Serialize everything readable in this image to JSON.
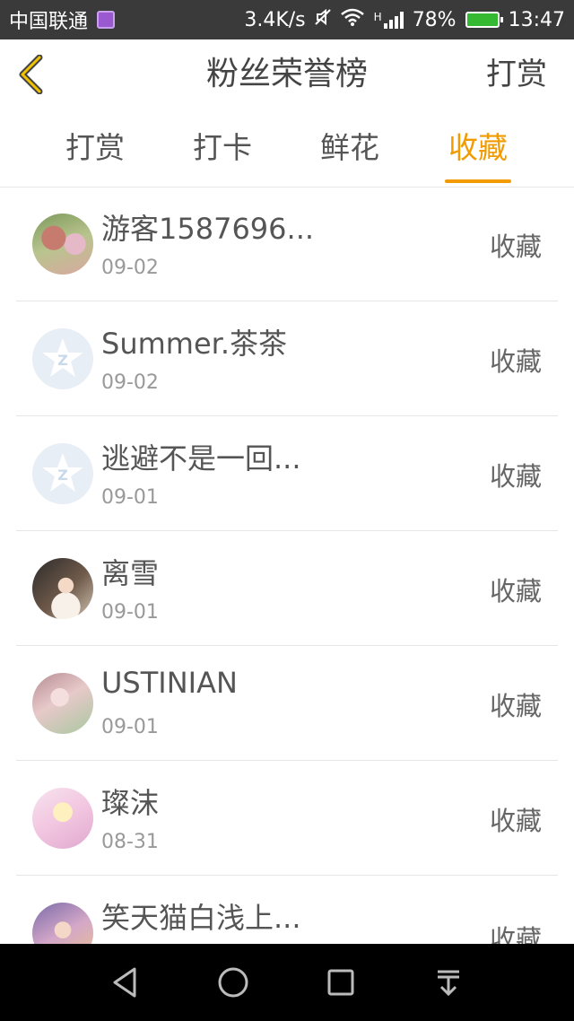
{
  "status_bar": {
    "carrier": "中国联通",
    "speed": "3.4K/s",
    "network_type": "H",
    "battery": "78%",
    "time": "13:47"
  },
  "header": {
    "title": "粉丝荣誉榜",
    "action": "打赏"
  },
  "tabs": [
    {
      "label": "打赏",
      "active": false
    },
    {
      "label": "打卡",
      "active": false
    },
    {
      "label": "鲜花",
      "active": false
    },
    {
      "label": "收藏",
      "active": true
    }
  ],
  "accent_color": "#f29b00",
  "items": [
    {
      "name": "游客1587696...",
      "date": "09-02",
      "action": "收藏",
      "avatar": "photo"
    },
    {
      "name": "Summer.茶茶",
      "date": "09-02",
      "action": "收藏",
      "avatar": "default"
    },
    {
      "name": "逃避不是一回...",
      "date": "09-01",
      "action": "收藏",
      "avatar": "default"
    },
    {
      "name": "离雪",
      "date": "09-01",
      "action": "收藏",
      "avatar": "photo"
    },
    {
      "name": "USTINIAN",
      "date": "09-01",
      "action": "收藏",
      "avatar": "photo"
    },
    {
      "name": "璨沫",
      "date": "08-31",
      "action": "收藏",
      "avatar": "photo"
    },
    {
      "name": "笑天猫白浅上...",
      "date": "",
      "action": "收藏",
      "avatar": "photo"
    }
  ]
}
